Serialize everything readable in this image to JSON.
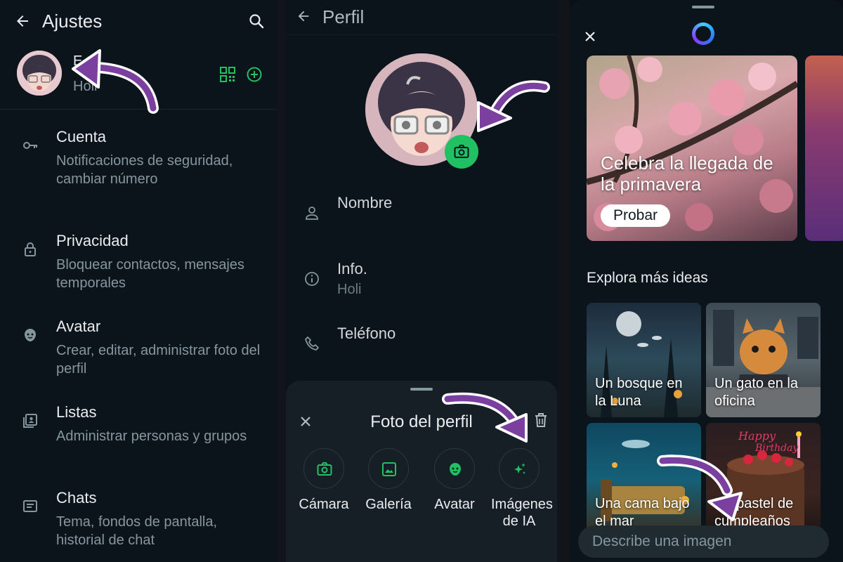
{
  "settings": {
    "title": "Ajustes",
    "profile": {
      "name": "E",
      "status": "Holi"
    },
    "items": [
      {
        "title": "Cuenta",
        "subtitle": "Notificaciones de seguridad, cambiar número",
        "icon": "key-icon"
      },
      {
        "title": "Privacidad",
        "subtitle": "Bloquear contactos, mensajes temporales",
        "icon": "lock-icon"
      },
      {
        "title": "Avatar",
        "subtitle": "Crear, editar, administrar foto del perfil",
        "icon": "avatar-icon"
      },
      {
        "title": "Listas",
        "subtitle": "Administrar personas y grupos",
        "icon": "lists-icon"
      },
      {
        "title": "Chats",
        "subtitle": "Tema, fondos de pantalla, historial de chat",
        "icon": "chat-icon"
      }
    ]
  },
  "profile": {
    "title": "Perfil",
    "name_label": "Nombre",
    "about_label": "Info.",
    "about_value": "Holi",
    "phone_label": "Teléfono",
    "sheet": {
      "title": "Foto del perfil",
      "options": [
        {
          "label": "Cámara",
          "icon": "camera-icon"
        },
        {
          "label": "Galería",
          "icon": "gallery-icon"
        },
        {
          "label": "Avatar",
          "icon": "avatar-icon"
        },
        {
          "label": "Imágenes de IA",
          "icon": "sparkle-icon"
        }
      ]
    }
  },
  "ai": {
    "hero": {
      "text": "Celebra la llegada de la primavera",
      "button": "Probar"
    },
    "explore_title": "Explora más ideas",
    "ideas": [
      {
        "text": "Un bosque en la Luna"
      },
      {
        "text": "Un gato en la oficina"
      },
      {
        "text": "Una cama bajo el mar"
      },
      {
        "text": "Un pastel de cumpleaños"
      }
    ],
    "prompt_placeholder": "Describe una imagen"
  },
  "colors": {
    "accent": "#21c063",
    "background": "#0b141a",
    "muted": "#8696a0",
    "annotation": "#7b3fa0"
  }
}
